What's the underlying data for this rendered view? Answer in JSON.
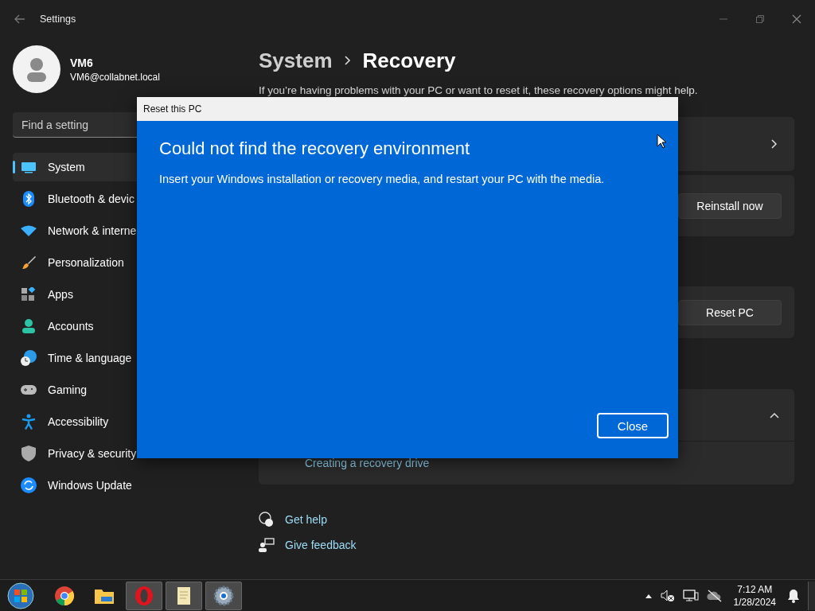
{
  "window": {
    "title": "Settings"
  },
  "account": {
    "name": "VM6",
    "email": "VM6@collabnet.local"
  },
  "search": {
    "placeholder": "Find a setting"
  },
  "sidebar": {
    "items": [
      {
        "label": "System",
        "selected": true
      },
      {
        "label": "Bluetooth & devic",
        "selected": false
      },
      {
        "label": "Network & interne",
        "selected": false
      },
      {
        "label": "Personalization",
        "selected": false
      },
      {
        "label": "Apps",
        "selected": false
      },
      {
        "label": "Accounts",
        "selected": false
      },
      {
        "label": "Time & language",
        "selected": false
      },
      {
        "label": "Gaming",
        "selected": false
      },
      {
        "label": "Accessibility",
        "selected": false
      },
      {
        "label": "Privacy & security",
        "selected": false
      },
      {
        "label": "Windows Update",
        "selected": false
      }
    ]
  },
  "breadcrumb": {
    "parent": "System",
    "current": "Recovery"
  },
  "description": "If you’re having problems with your PC or want to reset it, these recovery options might help.",
  "cards": [
    {
      "kind": "link"
    },
    {
      "kind": "button",
      "button": "Reinstall now"
    },
    {
      "kind": "button",
      "button": "Reset PC"
    },
    {
      "kind": "expander",
      "expanded": true,
      "links": [
        "Creating a recovery drive"
      ]
    }
  ],
  "footer_links": [
    "Get help",
    "Give feedback"
  ],
  "dialog": {
    "title": "Reset this PC",
    "heading": "Could not find the recovery environment",
    "message": "Insert your Windows installation or recovery media, and restart your PC with the media.",
    "button": "Close"
  },
  "taskbar": {
    "apps": [
      {
        "active": false
      },
      {
        "active": false
      },
      {
        "active": true
      },
      {
        "active": true
      },
      {
        "active": true
      }
    ],
    "time": "7:12 AM",
    "date": "1/28/2024"
  }
}
